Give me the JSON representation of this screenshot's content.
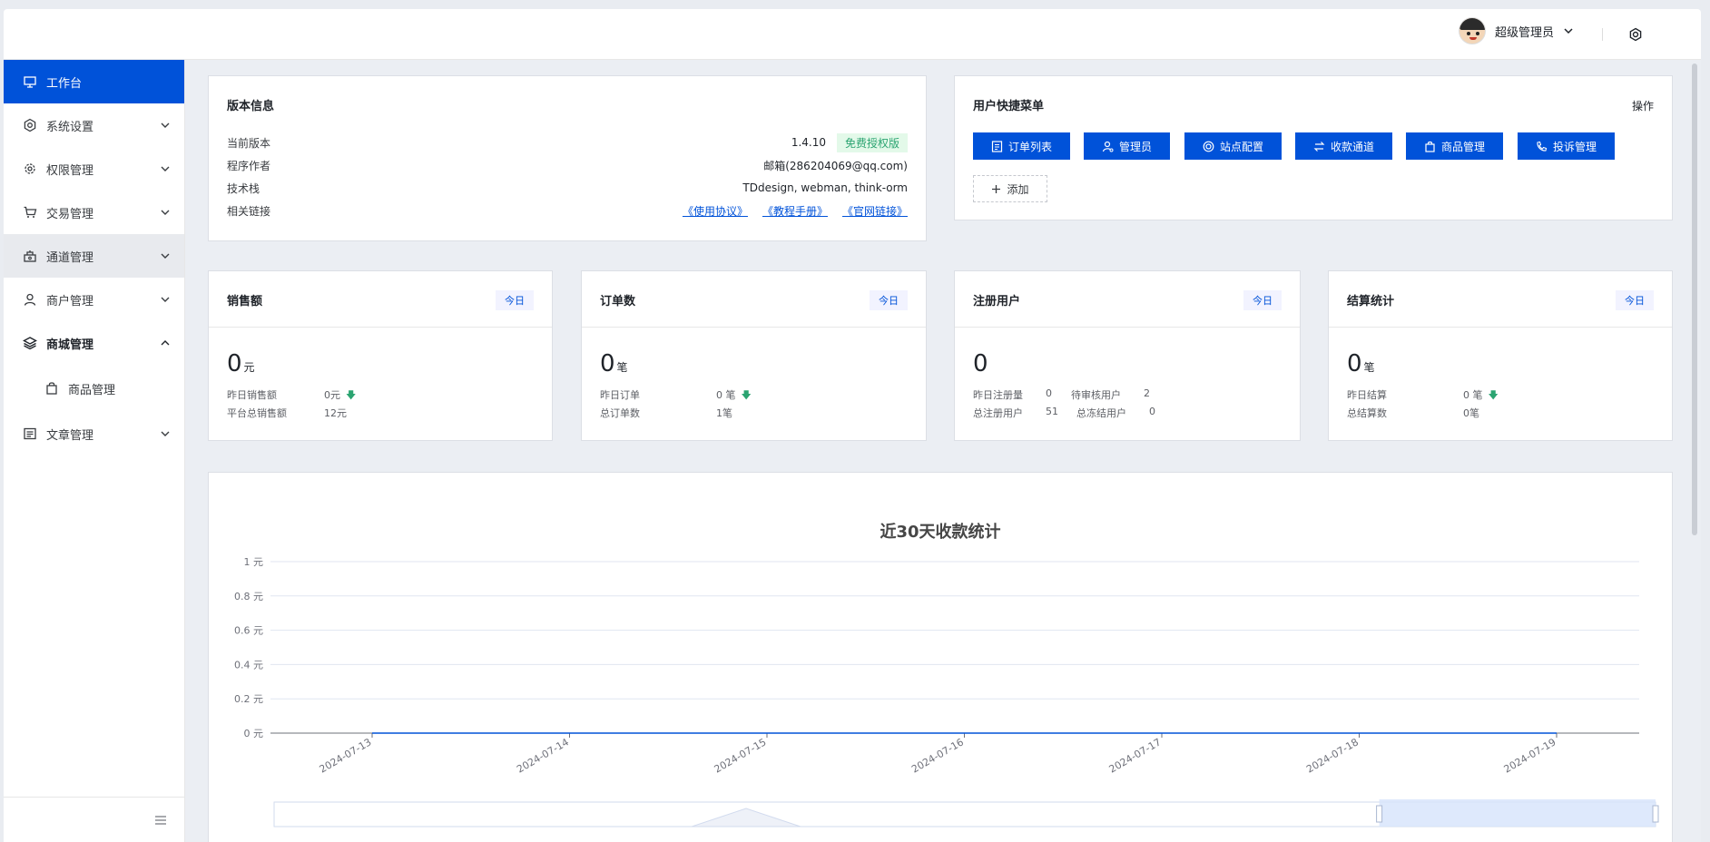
{
  "topbar": {
    "username": "超级管理员"
  },
  "sidebar": {
    "items": [
      {
        "label": "工作台",
        "icon": "monitor-icon"
      },
      {
        "label": "系统设置",
        "icon": "settings-icon"
      },
      {
        "label": "权限管理",
        "icon": "gear-icon"
      },
      {
        "label": "交易管理",
        "icon": "cart-icon"
      },
      {
        "label": "通道管理",
        "icon": "channel-icon"
      },
      {
        "label": "商户管理",
        "icon": "user-icon"
      },
      {
        "label": "商城管理",
        "icon": "layers-icon"
      },
      {
        "label": "商品管理",
        "icon": "bag-icon"
      },
      {
        "label": "文章管理",
        "icon": "article-icon"
      }
    ]
  },
  "version": {
    "title": "版本信息",
    "rows": [
      {
        "label": "当前版本",
        "value": "1.4.10",
        "tag": "免费授权版"
      },
      {
        "label": "程序作者",
        "value": "邮箱(286204069@qq.com)"
      },
      {
        "label": "技术栈",
        "value": "TDdesign, webman, think-orm"
      },
      {
        "label": "相关链接",
        "links": [
          "《使用协议》",
          "《教程手册》",
          "《官网链接》"
        ]
      }
    ]
  },
  "quick": {
    "title": "用户快捷菜单",
    "op": "操作",
    "buttons": [
      "订单列表",
      "管理员",
      "站点配置",
      "收款通道",
      "商品管理",
      "投诉管理"
    ],
    "add": "添加"
  },
  "stats": [
    {
      "title": "销售额",
      "today": "今日",
      "num": "0",
      "unit": "元",
      "r1l": "昨日销售额",
      "r1v": "0元",
      "r2l": "平台总销售额",
      "r2v": "12元"
    },
    {
      "title": "订单数",
      "today": "今日",
      "num": "0",
      "unit": "笔",
      "r1l": "昨日订单",
      "r1v": "0 笔",
      "r2l": "总订单数",
      "r2v": "1笔"
    },
    {
      "title": "注册用户",
      "today": "今日",
      "num": "0",
      "unit": "",
      "r1l": "昨日注册量",
      "r1v": "0",
      "r1l2": "待审核用户",
      "r1v2": "2",
      "r2l": "总注册用户",
      "r2v": "51",
      "r2l2": "总冻结用户",
      "r2v2": "0"
    },
    {
      "title": "结算统计",
      "today": "今日",
      "num": "0",
      "unit": "笔",
      "r1l": "昨日结算",
      "r1v": "0 笔",
      "r2l": "总结算数",
      "r2v": "0笔"
    }
  ],
  "chart_data": {
    "type": "line",
    "title": "近30天收款统计",
    "x": [
      "2024-07-13",
      "2024-07-14",
      "2024-07-15",
      "2024-07-16",
      "2024-07-17",
      "2024-07-18",
      "2024-07-19"
    ],
    "yticks": [
      "0 元",
      "0.2 元",
      "0.4 元",
      "0.6 元",
      "0.8 元",
      "1 元"
    ],
    "ylim": [
      0,
      1
    ],
    "series": [
      {
        "values": [
          0,
          0,
          0,
          0,
          0,
          0,
          0
        ]
      }
    ],
    "grid": true,
    "zoom_window": [
      0.8,
      1.0
    ],
    "colors": {
      "axis": "#6e7079",
      "grid": "#e0e6f1",
      "slider_fill": "#d6e4fb"
    }
  }
}
